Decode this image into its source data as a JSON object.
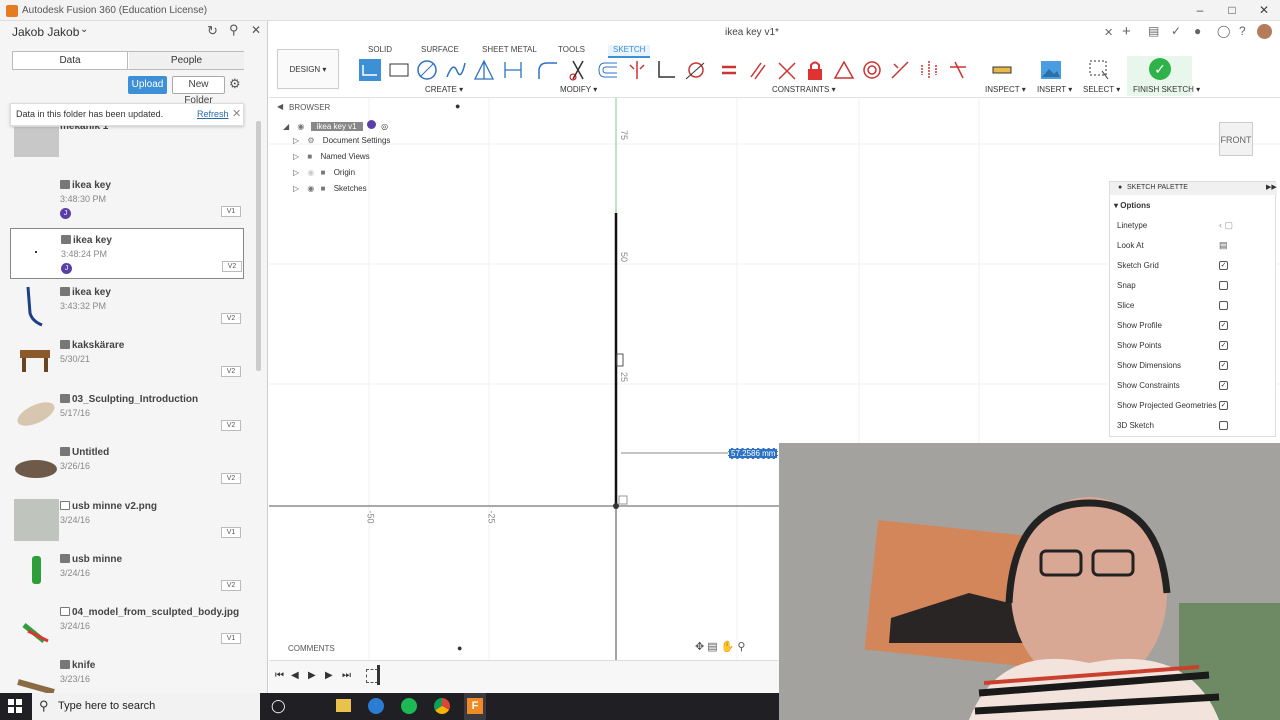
{
  "window": {
    "title": "Autodesk Fusion 360 (Education License)"
  },
  "data_panel": {
    "user": "Jakob Jakob",
    "tabs": [
      "Data",
      "People"
    ],
    "upload_label": "Upload",
    "new_folder_label": "New Folder",
    "notification": {
      "message": "Data in this folder has been updated.",
      "action": "Refresh"
    },
    "folder_name": "mekanik 1",
    "files": [
      {
        "name": "ikea key",
        "date": "3:48:30 PM",
        "version": "V1",
        "avatar": "J"
      },
      {
        "name": "ikea key",
        "date": "3:48:24 PM",
        "version": "V2",
        "avatar": "J",
        "selected": true
      },
      {
        "name": "ikea key",
        "date": "3:43:32 PM",
        "version": "V2"
      },
      {
        "name": "kakskärare",
        "date": "5/30/21",
        "version": "V2"
      },
      {
        "name": "03_Sculpting_Introduction",
        "date": "5/17/16",
        "version": "V2"
      },
      {
        "name": "Untitled",
        "date": "3/26/16",
        "version": "V2"
      },
      {
        "name": "usb minne v2.png",
        "date": "3/24/16",
        "version": "V1"
      },
      {
        "name": "usb minne",
        "date": "3/24/16",
        "version": "V2"
      },
      {
        "name": "04_model_from_sculpted_body.jpg",
        "date": "3/24/16",
        "version": "V1"
      },
      {
        "name": "knife",
        "date": "3/23/16",
        "version": ""
      }
    ]
  },
  "toolbar": {
    "doc_tab": "ikea key v1*",
    "workspace": "DESIGN",
    "workspace_tabs": [
      "SOLID",
      "SURFACE",
      "SHEET METAL",
      "TOOLS",
      "SKETCH"
    ],
    "groups": [
      "CREATE",
      "MODIFY",
      "CONSTRAINTS",
      "INSPECT",
      "INSERT",
      "SELECT",
      "FINISH SKETCH"
    ]
  },
  "browser": {
    "title": "BROWSER",
    "root": "ikea key v1",
    "nodes": [
      "Document Settings",
      "Named Views",
      "Origin",
      "Sketches"
    ]
  },
  "canvas": {
    "ticks_v": [
      "75",
      "50",
      "25"
    ],
    "ticks_h": [
      "-50",
      "-25"
    ],
    "dimension": "57.2586 mm",
    "viewcube": "FRONT",
    "comments": "COMMENTS"
  },
  "palette": {
    "title": "SKETCH PALETTE",
    "section": "Options",
    "rows": [
      {
        "label": "Linetype",
        "type": "icons"
      },
      {
        "label": "Look At",
        "type": "icon"
      },
      {
        "label": "Sketch Grid",
        "checked": true
      },
      {
        "label": "Snap",
        "checked": false
      },
      {
        "label": "Slice",
        "checked": false
      },
      {
        "label": "Show Profile",
        "checked": true
      },
      {
        "label": "Show Points",
        "checked": true
      },
      {
        "label": "Show Dimensions",
        "checked": true
      },
      {
        "label": "Show Constraints",
        "checked": true
      },
      {
        "label": "Show Projected Geometries",
        "checked": true
      },
      {
        "label": "3D Sketch",
        "checked": false
      }
    ]
  },
  "taskbar": {
    "search_placeholder": "Type here to search"
  },
  "colors": {
    "accent": "#3d8fd6",
    "finish": "#2fb24a",
    "avatar": "#5b3fa8"
  }
}
